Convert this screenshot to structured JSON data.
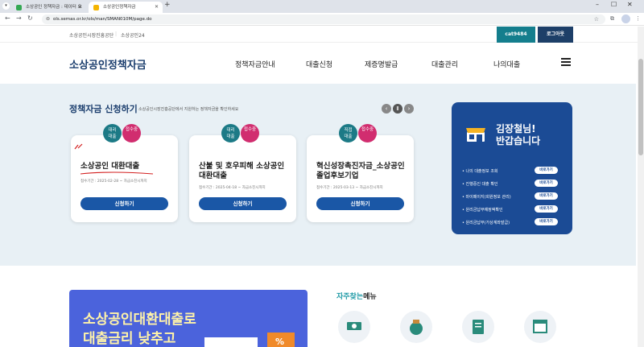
{
  "browser": {
    "tabs": [
      {
        "label": "소상공인 정책자금 : 데이터 요",
        "favicon_color": "#34a853"
      },
      {
        "label": "소상공인정책자금",
        "favicon_color": "#f4b400"
      }
    ],
    "url": "ols.semas.or.kr/ols/man/SMAN010M/page.do"
  },
  "util": {
    "org": "소상공인시장진흥공단",
    "sep": "|",
    "site24": "소상공인24",
    "user": "cat9484",
    "logout": "로그아웃"
  },
  "header": {
    "logo": "소상공인정책자금",
    "menu": [
      "정책자금안내",
      "대출신청",
      "제증명발급",
      "대출관리",
      "나의대출"
    ]
  },
  "hero": {
    "title": "정책자금 신청하기",
    "subtitle": "소상공인시장진흥공단에서 지원하는 정책자금을 확인하세요",
    "cards": [
      {
        "badge1": [
          "대리",
          "대출"
        ],
        "badge2": "접수중",
        "title": "소상공인 대환대출",
        "period": "접수기간 : 2025-02-28 ~ 자금소진시까지",
        "button": "신청하기"
      },
      {
        "badge1": [
          "대리",
          "대출"
        ],
        "badge2": "접수중",
        "title": "산불 및 호우피해 소상공인 대환대출",
        "period": "접수기간 : 2025-04-18 ~ 자금소진시까지",
        "button": "신청하기"
      },
      {
        "badge1": [
          "직접",
          "대출"
        ],
        "badge2": "접수중",
        "title": "혁신성장촉진자금_소상공인 졸업후보기업",
        "period": "접수기간 : 2025-03-13 ~ 자금소진시까지",
        "button": "신청하기"
      }
    ],
    "side": {
      "greeting_line1": "김장철님!",
      "greeting_line2": "반갑습니다",
      "items": [
        "나의 대출정보 조회",
        "진행중인 대출 확인",
        "마이페이지(회원정보 관리)",
        "원리금납부예정액확인",
        "원리금납부(가상계좌발급)"
      ],
      "goto_label": "바로가기"
    }
  },
  "banner": {
    "line1": "소상공인대환대출로",
    "line2": "대출금리 낮추고",
    "tag": "%"
  },
  "faq": {
    "title_accent": "자주찾는",
    "title_rest": "메뉴"
  },
  "colors": {
    "brand_navy": "#1a3d6d",
    "teal": "#1c7a86",
    "pink": "#d12d6f",
    "button_blue": "#1a57a6",
    "side_bg": "#1b4b95",
    "banner_bg": "#4b63dc"
  }
}
